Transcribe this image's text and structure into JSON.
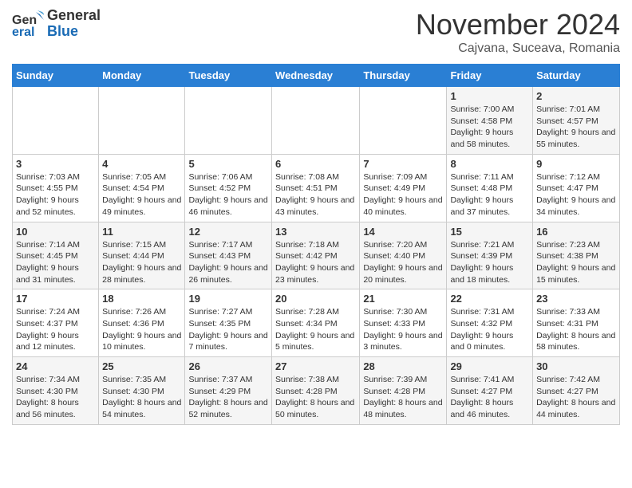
{
  "header": {
    "logo_line1": "General",
    "logo_line2": "Blue",
    "month_title": "November 2024",
    "location": "Cajvana, Suceava, Romania"
  },
  "weekdays": [
    "Sunday",
    "Monday",
    "Tuesday",
    "Wednesday",
    "Thursday",
    "Friday",
    "Saturday"
  ],
  "weeks": [
    [
      {
        "day": "",
        "info": ""
      },
      {
        "day": "",
        "info": ""
      },
      {
        "day": "",
        "info": ""
      },
      {
        "day": "",
        "info": ""
      },
      {
        "day": "",
        "info": ""
      },
      {
        "day": "1",
        "info": "Sunrise: 7:00 AM\nSunset: 4:58 PM\nDaylight: 9 hours and 58 minutes."
      },
      {
        "day": "2",
        "info": "Sunrise: 7:01 AM\nSunset: 4:57 PM\nDaylight: 9 hours and 55 minutes."
      }
    ],
    [
      {
        "day": "3",
        "info": "Sunrise: 7:03 AM\nSunset: 4:55 PM\nDaylight: 9 hours and 52 minutes."
      },
      {
        "day": "4",
        "info": "Sunrise: 7:05 AM\nSunset: 4:54 PM\nDaylight: 9 hours and 49 minutes."
      },
      {
        "day": "5",
        "info": "Sunrise: 7:06 AM\nSunset: 4:52 PM\nDaylight: 9 hours and 46 minutes."
      },
      {
        "day": "6",
        "info": "Sunrise: 7:08 AM\nSunset: 4:51 PM\nDaylight: 9 hours and 43 minutes."
      },
      {
        "day": "7",
        "info": "Sunrise: 7:09 AM\nSunset: 4:49 PM\nDaylight: 9 hours and 40 minutes."
      },
      {
        "day": "8",
        "info": "Sunrise: 7:11 AM\nSunset: 4:48 PM\nDaylight: 9 hours and 37 minutes."
      },
      {
        "day": "9",
        "info": "Sunrise: 7:12 AM\nSunset: 4:47 PM\nDaylight: 9 hours and 34 minutes."
      }
    ],
    [
      {
        "day": "10",
        "info": "Sunrise: 7:14 AM\nSunset: 4:45 PM\nDaylight: 9 hours and 31 minutes."
      },
      {
        "day": "11",
        "info": "Sunrise: 7:15 AM\nSunset: 4:44 PM\nDaylight: 9 hours and 28 minutes."
      },
      {
        "day": "12",
        "info": "Sunrise: 7:17 AM\nSunset: 4:43 PM\nDaylight: 9 hours and 26 minutes."
      },
      {
        "day": "13",
        "info": "Sunrise: 7:18 AM\nSunset: 4:42 PM\nDaylight: 9 hours and 23 minutes."
      },
      {
        "day": "14",
        "info": "Sunrise: 7:20 AM\nSunset: 4:40 PM\nDaylight: 9 hours and 20 minutes."
      },
      {
        "day": "15",
        "info": "Sunrise: 7:21 AM\nSunset: 4:39 PM\nDaylight: 9 hours and 18 minutes."
      },
      {
        "day": "16",
        "info": "Sunrise: 7:23 AM\nSunset: 4:38 PM\nDaylight: 9 hours and 15 minutes."
      }
    ],
    [
      {
        "day": "17",
        "info": "Sunrise: 7:24 AM\nSunset: 4:37 PM\nDaylight: 9 hours and 12 minutes."
      },
      {
        "day": "18",
        "info": "Sunrise: 7:26 AM\nSunset: 4:36 PM\nDaylight: 9 hours and 10 minutes."
      },
      {
        "day": "19",
        "info": "Sunrise: 7:27 AM\nSunset: 4:35 PM\nDaylight: 9 hours and 7 minutes."
      },
      {
        "day": "20",
        "info": "Sunrise: 7:28 AM\nSunset: 4:34 PM\nDaylight: 9 hours and 5 minutes."
      },
      {
        "day": "21",
        "info": "Sunrise: 7:30 AM\nSunset: 4:33 PM\nDaylight: 9 hours and 3 minutes."
      },
      {
        "day": "22",
        "info": "Sunrise: 7:31 AM\nSunset: 4:32 PM\nDaylight: 9 hours and 0 minutes."
      },
      {
        "day": "23",
        "info": "Sunrise: 7:33 AM\nSunset: 4:31 PM\nDaylight: 8 hours and 58 minutes."
      }
    ],
    [
      {
        "day": "24",
        "info": "Sunrise: 7:34 AM\nSunset: 4:30 PM\nDaylight: 8 hours and 56 minutes."
      },
      {
        "day": "25",
        "info": "Sunrise: 7:35 AM\nSunset: 4:30 PM\nDaylight: 8 hours and 54 minutes."
      },
      {
        "day": "26",
        "info": "Sunrise: 7:37 AM\nSunset: 4:29 PM\nDaylight: 8 hours and 52 minutes."
      },
      {
        "day": "27",
        "info": "Sunrise: 7:38 AM\nSunset: 4:28 PM\nDaylight: 8 hours and 50 minutes."
      },
      {
        "day": "28",
        "info": "Sunrise: 7:39 AM\nSunset: 4:28 PM\nDaylight: 8 hours and 48 minutes."
      },
      {
        "day": "29",
        "info": "Sunrise: 7:41 AM\nSunset: 4:27 PM\nDaylight: 8 hours and 46 minutes."
      },
      {
        "day": "30",
        "info": "Sunrise: 7:42 AM\nSunset: 4:27 PM\nDaylight: 8 hours and 44 minutes."
      }
    ]
  ]
}
